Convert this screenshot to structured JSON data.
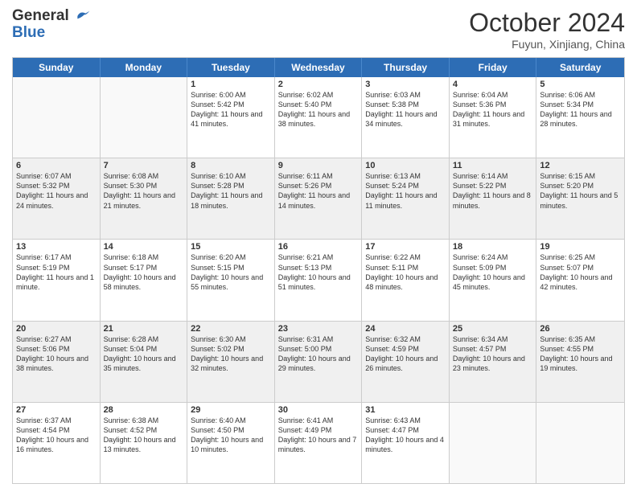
{
  "header": {
    "logo_line1": "General",
    "logo_line2": "Blue",
    "month_title": "October 2024",
    "location": "Fuyun, Xinjiang, China"
  },
  "days_of_week": [
    "Sunday",
    "Monday",
    "Tuesday",
    "Wednesday",
    "Thursday",
    "Friday",
    "Saturday"
  ],
  "weeks": [
    [
      {
        "day": "",
        "empty": true
      },
      {
        "day": "",
        "empty": true
      },
      {
        "day": "1",
        "sunrise": "6:00 AM",
        "sunset": "5:42 PM",
        "daylight": "11 hours and 41 minutes."
      },
      {
        "day": "2",
        "sunrise": "6:02 AM",
        "sunset": "5:40 PM",
        "daylight": "11 hours and 38 minutes."
      },
      {
        "day": "3",
        "sunrise": "6:03 AM",
        "sunset": "5:38 PM",
        "daylight": "11 hours and 34 minutes."
      },
      {
        "day": "4",
        "sunrise": "6:04 AM",
        "sunset": "5:36 PM",
        "daylight": "11 hours and 31 minutes."
      },
      {
        "day": "5",
        "sunrise": "6:06 AM",
        "sunset": "5:34 PM",
        "daylight": "11 hours and 28 minutes."
      }
    ],
    [
      {
        "day": "6",
        "sunrise": "6:07 AM",
        "sunset": "5:32 PM",
        "daylight": "11 hours and 24 minutes."
      },
      {
        "day": "7",
        "sunrise": "6:08 AM",
        "sunset": "5:30 PM",
        "daylight": "11 hours and 21 minutes."
      },
      {
        "day": "8",
        "sunrise": "6:10 AM",
        "sunset": "5:28 PM",
        "daylight": "11 hours and 18 minutes."
      },
      {
        "day": "9",
        "sunrise": "6:11 AM",
        "sunset": "5:26 PM",
        "daylight": "11 hours and 14 minutes."
      },
      {
        "day": "10",
        "sunrise": "6:13 AM",
        "sunset": "5:24 PM",
        "daylight": "11 hours and 11 minutes."
      },
      {
        "day": "11",
        "sunrise": "6:14 AM",
        "sunset": "5:22 PM",
        "daylight": "11 hours and 8 minutes."
      },
      {
        "day": "12",
        "sunrise": "6:15 AM",
        "sunset": "5:20 PM",
        "daylight": "11 hours and 5 minutes."
      }
    ],
    [
      {
        "day": "13",
        "sunrise": "6:17 AM",
        "sunset": "5:19 PM",
        "daylight": "11 hours and 1 minute."
      },
      {
        "day": "14",
        "sunrise": "6:18 AM",
        "sunset": "5:17 PM",
        "daylight": "10 hours and 58 minutes."
      },
      {
        "day": "15",
        "sunrise": "6:20 AM",
        "sunset": "5:15 PM",
        "daylight": "10 hours and 55 minutes."
      },
      {
        "day": "16",
        "sunrise": "6:21 AM",
        "sunset": "5:13 PM",
        "daylight": "10 hours and 51 minutes."
      },
      {
        "day": "17",
        "sunrise": "6:22 AM",
        "sunset": "5:11 PM",
        "daylight": "10 hours and 48 minutes."
      },
      {
        "day": "18",
        "sunrise": "6:24 AM",
        "sunset": "5:09 PM",
        "daylight": "10 hours and 45 minutes."
      },
      {
        "day": "19",
        "sunrise": "6:25 AM",
        "sunset": "5:07 PM",
        "daylight": "10 hours and 42 minutes."
      }
    ],
    [
      {
        "day": "20",
        "sunrise": "6:27 AM",
        "sunset": "5:06 PM",
        "daylight": "10 hours and 38 minutes."
      },
      {
        "day": "21",
        "sunrise": "6:28 AM",
        "sunset": "5:04 PM",
        "daylight": "10 hours and 35 minutes."
      },
      {
        "day": "22",
        "sunrise": "6:30 AM",
        "sunset": "5:02 PM",
        "daylight": "10 hours and 32 minutes."
      },
      {
        "day": "23",
        "sunrise": "6:31 AM",
        "sunset": "5:00 PM",
        "daylight": "10 hours and 29 minutes."
      },
      {
        "day": "24",
        "sunrise": "6:32 AM",
        "sunset": "4:59 PM",
        "daylight": "10 hours and 26 minutes."
      },
      {
        "day": "25",
        "sunrise": "6:34 AM",
        "sunset": "4:57 PM",
        "daylight": "10 hours and 23 minutes."
      },
      {
        "day": "26",
        "sunrise": "6:35 AM",
        "sunset": "4:55 PM",
        "daylight": "10 hours and 19 minutes."
      }
    ],
    [
      {
        "day": "27",
        "sunrise": "6:37 AM",
        "sunset": "4:54 PM",
        "daylight": "10 hours and 16 minutes."
      },
      {
        "day": "28",
        "sunrise": "6:38 AM",
        "sunset": "4:52 PM",
        "daylight": "10 hours and 13 minutes."
      },
      {
        "day": "29",
        "sunrise": "6:40 AM",
        "sunset": "4:50 PM",
        "daylight": "10 hours and 10 minutes."
      },
      {
        "day": "30",
        "sunrise": "6:41 AM",
        "sunset": "4:49 PM",
        "daylight": "10 hours and 7 minutes."
      },
      {
        "day": "31",
        "sunrise": "6:43 AM",
        "sunset": "4:47 PM",
        "daylight": "10 hours and 4 minutes."
      },
      {
        "day": "",
        "empty": true
      },
      {
        "day": "",
        "empty": true
      }
    ]
  ]
}
